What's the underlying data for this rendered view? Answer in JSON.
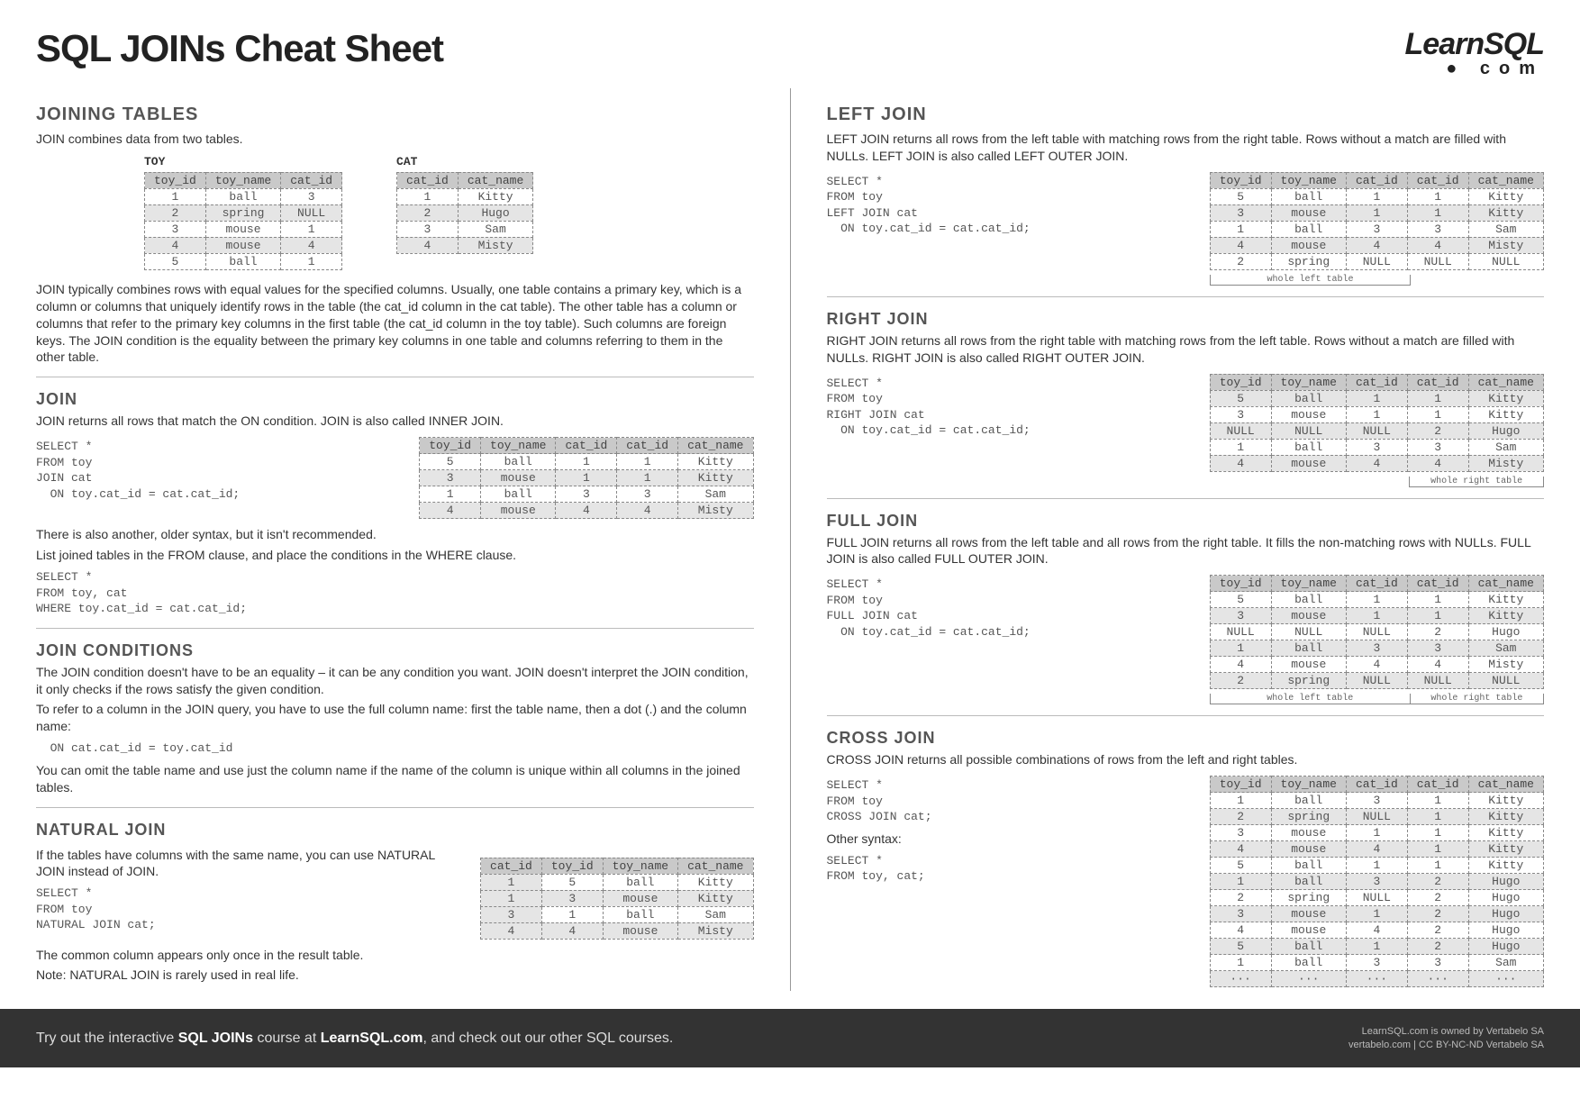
{
  "title": "SQL JOINs Cheat Sheet",
  "logo": {
    "line1": "LearnSQL",
    "line2": "● com"
  },
  "left": {
    "h_joining": "JOINING TABLES",
    "p_intro": "JOIN combines data from two tables.",
    "toy_caption": "TOY",
    "cat_caption": "CAT",
    "toy_table": {
      "cols": [
        "toy_id",
        "toy_name",
        "cat_id"
      ],
      "rows": [
        [
          "1",
          "ball",
          "3"
        ],
        [
          "2",
          "spring",
          "NULL"
        ],
        [
          "3",
          "mouse",
          "1"
        ],
        [
          "4",
          "mouse",
          "4"
        ],
        [
          "5",
          "ball",
          "1"
        ]
      ]
    },
    "cat_table": {
      "cols": [
        "cat_id",
        "cat_name"
      ],
      "rows": [
        [
          "1",
          "Kitty"
        ],
        [
          "2",
          "Hugo"
        ],
        [
          "3",
          "Sam"
        ],
        [
          "4",
          "Misty"
        ]
      ]
    },
    "p_join_desc": "JOIN typically combines rows with equal values for the specified columns. Usually, one table contains a primary key, which is a column or columns that uniquely identify rows in the table (the cat_id column in the cat table). The other table has a column or columns that refer to the primary key columns in the first table (the cat_id column in the toy table). Such columns are foreign keys. The JOIN condition is the equality between the primary key columns in one table and columns referring to them in the other table.",
    "h_join": "JOIN",
    "p_join": "JOIN returns all rows that match the ON condition. JOIN is also called INNER JOIN.",
    "code_join": "SELECT *\nFROM toy\nJOIN cat\n  ON toy.cat_id = cat.cat_id;",
    "join_result": {
      "cols": [
        "toy_id",
        "toy_name",
        "cat_id",
        "cat_id",
        "cat_name"
      ],
      "rows": [
        [
          "5",
          "ball",
          "1",
          "1",
          "Kitty"
        ],
        [
          "3",
          "mouse",
          "1",
          "1",
          "Kitty"
        ],
        [
          "1",
          "ball",
          "3",
          "3",
          "Sam"
        ],
        [
          "4",
          "mouse",
          "4",
          "4",
          "Misty"
        ]
      ]
    },
    "p_old1": "There is also another, older syntax, but it isn't recommended.",
    "p_old2": "List joined tables in the FROM clause, and place the conditions in the WHERE clause.",
    "code_old": "SELECT *\nFROM toy, cat\nWHERE toy.cat_id = cat.cat_id;",
    "h_cond": "JOIN CONDITIONS",
    "p_cond1": "The JOIN condition doesn't have to be an equality – it can be any condition you want. JOIN doesn't interpret the JOIN condition, it only checks if the rows satisfy the given condition.",
    "p_cond2": "To refer to a column in the JOIN query, you have to use the full column name: first the table name, then a dot (.) and the column name:",
    "code_cond": "  ON cat.cat_id = toy.cat_id",
    "p_cond3": "You can omit the table name and use just the column name if the name of the column is unique within all columns in the joined tables.",
    "h_natural": "NATURAL JOIN",
    "p_nat1": "If the tables have columns with the same name, you can use NATURAL JOIN instead of JOIN.",
    "code_nat": "SELECT *\nFROM toy\nNATURAL JOIN cat;",
    "nat_result": {
      "cols": [
        "cat_id",
        "toy_id",
        "toy_name",
        "cat_name"
      ],
      "rows": [
        [
          "1",
          "5",
          "ball",
          "Kitty"
        ],
        [
          "1",
          "3",
          "mouse",
          "Kitty"
        ],
        [
          "3",
          "1",
          "ball",
          "Sam"
        ],
        [
          "4",
          "4",
          "mouse",
          "Misty"
        ]
      ]
    },
    "p_nat2": "The common column appears only once in the result table.",
    "p_nat3": "Note:  NATURAL JOIN is rarely used in real life."
  },
  "right": {
    "h_left": "LEFT JOIN",
    "p_left": "LEFT JOIN returns all rows from the left table with matching rows from the right table. Rows without a match are filled with NULLs. LEFT JOIN is also called LEFT OUTER JOIN.",
    "code_left": "SELECT *\nFROM toy\nLEFT JOIN cat\n  ON toy.cat_id = cat.cat_id;",
    "left_result": {
      "cols": [
        "toy_id",
        "toy_name",
        "cat_id",
        "cat_id",
        "cat_name"
      ],
      "rows": [
        [
          "5",
          "ball",
          "1",
          "1",
          "Kitty"
        ],
        [
          "3",
          "mouse",
          "1",
          "1",
          "Kitty"
        ],
        [
          "1",
          "ball",
          "3",
          "3",
          "Sam"
        ],
        [
          "4",
          "mouse",
          "4",
          "4",
          "Misty"
        ],
        [
          "2",
          "spring",
          "NULL",
          "NULL",
          "NULL"
        ]
      ],
      "foot_left": "whole left table"
    },
    "h_right": "RIGHT JOIN",
    "p_right": "RIGHT JOIN returns all rows from the right table with matching rows from the left table. Rows without a match are filled with NULLs. RIGHT JOIN is also called RIGHT OUTER JOIN.",
    "code_right": "SELECT *\nFROM toy\nRIGHT JOIN cat\n  ON toy.cat_id = cat.cat_id;",
    "right_result": {
      "cols": [
        "toy_id",
        "toy_name",
        "cat_id",
        "cat_id",
        "cat_name"
      ],
      "rows": [
        [
          "5",
          "ball",
          "1",
          "1",
          "Kitty"
        ],
        [
          "3",
          "mouse",
          "1",
          "1",
          "Kitty"
        ],
        [
          "NULL",
          "NULL",
          "NULL",
          "2",
          "Hugo"
        ],
        [
          "1",
          "ball",
          "3",
          "3",
          "Sam"
        ],
        [
          "4",
          "mouse",
          "4",
          "4",
          "Misty"
        ]
      ],
      "foot_right": "whole right table"
    },
    "h_full": "FULL JOIN",
    "p_full": "FULL JOIN returns all rows from the left table and all rows from the right table. It fills the non-matching rows with NULLs. FULL JOIN is also called FULL OUTER JOIN.",
    "code_full": "SELECT *\nFROM toy\nFULL JOIN cat\n  ON toy.cat_id = cat.cat_id;",
    "full_result": {
      "cols": [
        "toy_id",
        "toy_name",
        "cat_id",
        "cat_id",
        "cat_name"
      ],
      "rows": [
        [
          "5",
          "ball",
          "1",
          "1",
          "Kitty"
        ],
        [
          "3",
          "mouse",
          "1",
          "1",
          "Kitty"
        ],
        [
          "NULL",
          "NULL",
          "NULL",
          "2",
          "Hugo"
        ],
        [
          "1",
          "ball",
          "3",
          "3",
          "Sam"
        ],
        [
          "4",
          "mouse",
          "4",
          "4",
          "Misty"
        ],
        [
          "2",
          "spring",
          "NULL",
          "NULL",
          "NULL"
        ]
      ],
      "foot_left": "whole left table",
      "foot_right": "whole right table"
    },
    "h_cross": "CROSS JOIN",
    "p_cross": "CROSS JOIN returns all possible combinations of rows from the left and right tables.",
    "code_cross1": "SELECT *\nFROM toy\nCROSS JOIN cat;",
    "p_cross_other": "Other syntax:",
    "code_cross2": "SELECT *\nFROM toy, cat;",
    "cross_result": {
      "cols": [
        "toy_id",
        "toy_name",
        "cat_id",
        "cat_id",
        "cat_name"
      ],
      "rows": [
        [
          "1",
          "ball",
          "3",
          "1",
          "Kitty"
        ],
        [
          "2",
          "spring",
          "NULL",
          "1",
          "Kitty"
        ],
        [
          "3",
          "mouse",
          "1",
          "1",
          "Kitty"
        ],
        [
          "4",
          "mouse",
          "4",
          "1",
          "Kitty"
        ],
        [
          "5",
          "ball",
          "1",
          "1",
          "Kitty"
        ],
        [
          "1",
          "ball",
          "3",
          "2",
          "Hugo"
        ],
        [
          "2",
          "spring",
          "NULL",
          "2",
          "Hugo"
        ],
        [
          "3",
          "mouse",
          "1",
          "2",
          "Hugo"
        ],
        [
          "4",
          "mouse",
          "4",
          "2",
          "Hugo"
        ],
        [
          "5",
          "ball",
          "1",
          "2",
          "Hugo"
        ],
        [
          "1",
          "ball",
          "3",
          "3",
          "Sam"
        ],
        [
          "···",
          "···",
          "···",
          "···",
          "···"
        ]
      ]
    }
  },
  "footer": {
    "cta_pre": "Try out the interactive ",
    "cta_b1": "SQL JOINs",
    "cta_mid": " course at ",
    "cta_b2": "LearnSQL.com",
    "cta_post": ", and check out our other SQL courses.",
    "r1": "LearnSQL.com is owned by Vertabelo SA",
    "r2": "vertabelo.com | CC BY-NC-ND Vertabelo SA"
  }
}
